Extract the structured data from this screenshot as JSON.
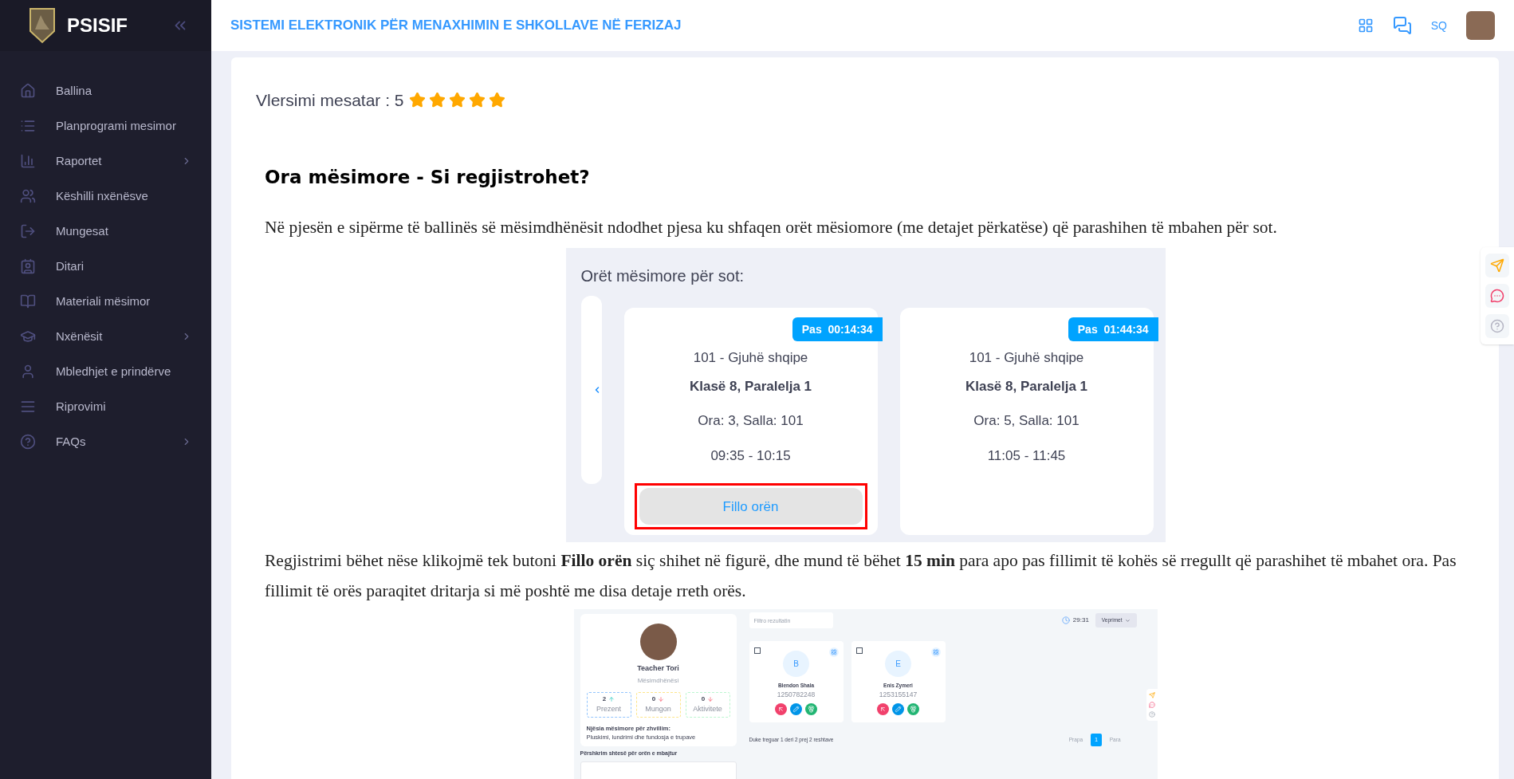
{
  "brand": {
    "name": "PSISIF"
  },
  "sidebar": {
    "items": [
      {
        "label": "Ballina",
        "has_submenu": false
      },
      {
        "label": "Planprogrami mesimor",
        "has_submenu": false
      },
      {
        "label": "Raportet",
        "has_submenu": true
      },
      {
        "label": "Këshilli nxënësve",
        "has_submenu": false
      },
      {
        "label": "Mungesat",
        "has_submenu": false
      },
      {
        "label": "Ditari",
        "has_submenu": false
      },
      {
        "label": "Materiali mësimor",
        "has_submenu": false
      },
      {
        "label": "Nxënësit",
        "has_submenu": true
      },
      {
        "label": "Mbledhjet e prindërve",
        "has_submenu": false
      },
      {
        "label": "Riprovimi",
        "has_submenu": false
      },
      {
        "label": "FAQs",
        "has_submenu": true
      }
    ]
  },
  "header": {
    "title": "SISTEMI ELEKTRONIK PËR MENAXHIMIN E SHKOLLAVE NË FERIZAJ",
    "language": "SQ"
  },
  "rating": {
    "label": "Vlersimi mesatar : 5",
    "stars": 5
  },
  "article": {
    "heading": "Ora mësimore - Si regjistrohet?",
    "intro": "Në pjesën e sipërme të ballinës së mësimdhënësit ndodhet pjesa  ku shfaqen orët mësiomore (me detajet përkatëse) që parashihen të mbahen për sot.",
    "lessons_screenshot": {
      "title": "Orët mësimore për sot:",
      "cards": [
        {
          "badge": "Pas  00:14:34",
          "subject": "101 - Gjuhë shqipe",
          "class": "Klasë 8, Paralelja 1",
          "room": "Ora: 3, Salla: 101",
          "time": "09:35 - 10:15",
          "button": "Fillo orën",
          "highlighted": true
        },
        {
          "badge": "Pas  01:44:34",
          "subject": "101 - Gjuhë shqipe",
          "class": "Klasë 8, Paralelja 1",
          "room": "Ora: 5, Salla: 101",
          "time": "11:05 - 11:45"
        }
      ]
    },
    "explanation": "Regjistrimi bëhet nëse klikojmë tek butoni **Fillo orën** siç shihet në figurë, dhe mund të bëhet **15 min** para apo pas fillimit të kohës së rregullt që parashihet të mbahet ora. Pas fillimit të orës paraqitet dritarja si më poshtë me disa detaje rreth orës.",
    "class_screenshot": {
      "teacher": {
        "name": "Teacher Tori",
        "role": "Mësimdhënësi"
      },
      "stats": [
        {
          "value": "2",
          "label": "Prezent",
          "kind": "up",
          "color": "#93c5fd"
        },
        {
          "value": "0",
          "label": "Mungon",
          "kind": "down",
          "color": "#fde68a"
        },
        {
          "value": "0",
          "label": "Aktivitete",
          "kind": "down",
          "color": "#bbf7d0"
        }
      ],
      "unit_label": "Njësia mësimore për zhvillim:",
      "unit": "Pluskimi, lundrimi dhe fundosja e trupave",
      "description_label": "Përshkrim shtesë për orën e mbajtur",
      "filter": {
        "placeholder": "Filtro rezultatin"
      },
      "timer": "29:31",
      "actions": "Veprimet",
      "students": [
        {
          "initial": "B",
          "name": "Blendon Shala",
          "id": "1250782248",
          "checked": false
        },
        {
          "initial": "E",
          "name": "Enis Zymeri",
          "id": "1253155147",
          "checked": false
        }
      ],
      "footer": "Duke treguar 1 deri 2 prej 2 reshtave",
      "pagination": [
        {
          "label": "Prapa",
          "selected": false
        },
        {
          "label": "1",
          "selected": true
        },
        {
          "label": "Para",
          "selected": false
        }
      ]
    }
  }
}
